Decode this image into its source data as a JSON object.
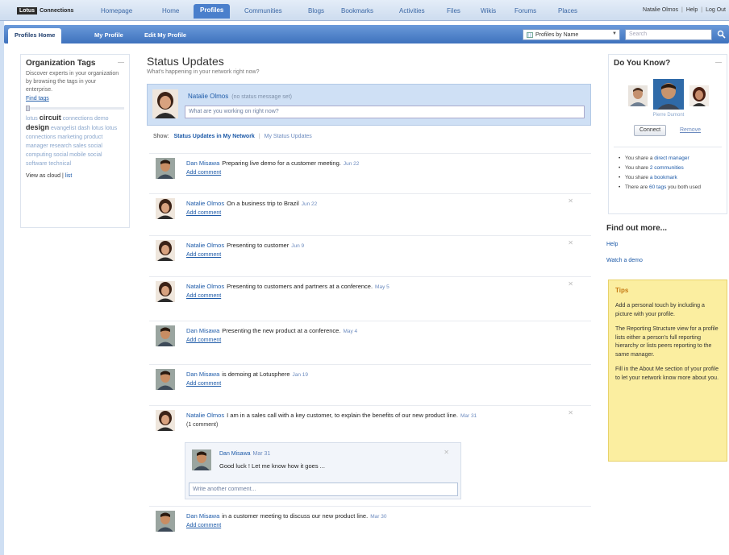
{
  "topnav": {
    "logo_box": "Lotus",
    "logo_text": "Connections",
    "items": [
      "Homepage",
      "Home",
      "Profiles",
      "Communities",
      "Blogs",
      "Bookmarks",
      "Activities",
      "Files",
      "Wikis",
      "Forums",
      "Places"
    ],
    "active": "Profiles",
    "user": "Natalie Olmos",
    "help": "Help",
    "logout": "Log Out"
  },
  "subnav": {
    "tabs": [
      "Profiles Home",
      "My Profile",
      "Edit My Profile"
    ],
    "active": "Profiles Home",
    "search_scope": "Profiles by Name",
    "search_placeholder": "Search"
  },
  "org_tags": {
    "title": "Organization Tags",
    "description": "Discover experts in your organization by browsing the tags in your enterprise.",
    "find_tags": "Find tags",
    "tags": [
      {
        "text": "lotus",
        "big": false
      },
      {
        "text": "circuit",
        "big": true
      },
      {
        "text": "connections",
        "big": false
      },
      {
        "text": "demo",
        "big": false
      },
      {
        "text": "design",
        "big": true
      },
      {
        "text": "evangelist",
        "big": false
      },
      {
        "text": "dash lotus lotus connections",
        "big": false
      },
      {
        "text": "marketing product manager",
        "big": false
      },
      {
        "text": "research sales social",
        "big": false
      },
      {
        "text": "computing social mobile",
        "big": false
      },
      {
        "text": "social software technical",
        "big": false
      }
    ],
    "view_as_label": "View as cloud",
    "view_as_alt": "list"
  },
  "status": {
    "title": "Status Updates",
    "subtitle": "What's happening in your network right now?",
    "compose_name": "Natalie Olmos",
    "compose_note": "(no status message set)",
    "compose_placeholder": "What are you working on right now?",
    "show_label": "Show:",
    "show_selected": "Status Updates in My Network",
    "show_other": "My Status Updates"
  },
  "feed": [
    {
      "who": "Dan Misawa",
      "text": "Preparing live demo for a customer meeting.",
      "date": "Jun 22",
      "action": "Add comment",
      "person": "dan",
      "closable": false
    },
    {
      "who": "Natalie Olmos",
      "text": "On a business trip to Brazil",
      "date": "Jun 22",
      "action": "Add comment",
      "person": "natalie",
      "closable": true
    },
    {
      "who": "Natalie Olmos",
      "text": "Presenting to customer",
      "date": "Jun 9",
      "action": "Add comment",
      "person": "natalie",
      "closable": true
    },
    {
      "who": "Natalie Olmos",
      "text": "Presenting to customers and partners at a conference.",
      "date": "May 5",
      "action": "Add comment",
      "person": "natalie",
      "closable": true
    },
    {
      "who": "Dan Misawa",
      "text": "Presenting the new product at a conference.",
      "date": "May 4",
      "action": "Add comment",
      "person": "dan",
      "closable": false
    },
    {
      "who": "Dan Misawa",
      "text": "is demoing at Lotusphere",
      "date": "Jan 19",
      "action": "Add comment",
      "person": "dan",
      "closable": false
    },
    {
      "who": "Natalie Olmos",
      "text": "I am in a sales call with a key customer, to explain the benefits of our new product line.",
      "date": "Mar 31",
      "action": "(1 comment)",
      "person": "natalie",
      "closable": true
    },
    {
      "who": "Dan Misawa",
      "text": "in a customer meeting to discuss our new product line.",
      "date": "Mar 30",
      "action": "Add comment",
      "person": "dan",
      "closable": false
    }
  ],
  "reply": {
    "who": "Dan Misawa",
    "date": "Mar 31",
    "text": "Good luck ! Let me know how it goes ...",
    "placeholder": "Write another comment..."
  },
  "do_you_know": {
    "title": "Do You Know?",
    "person_name": "Pierre Dumont",
    "connect": "Connect",
    "remove": "Remove",
    "items": [
      {
        "pre": "You share a ",
        "link": "direct manager",
        "post": ""
      },
      {
        "pre": "You share ",
        "link": "2 communities",
        "post": ""
      },
      {
        "pre": "You share ",
        "link": "a bookmark",
        "post": ""
      },
      {
        "pre": "There are ",
        "link": "60 tags",
        "post": " you both used"
      }
    ]
  },
  "find_out_more": {
    "title": "Find out more...",
    "links": [
      "Help",
      "Watch a demo"
    ]
  },
  "tips": {
    "title": "Tips",
    "paragraphs": [
      "Add a personal touch by including a picture with your profile.",
      "The Reporting Structure view for a profile lists either a person's full reporting hierarchy or lists peers reporting to the same manager.",
      "Fill in the About Me section of your profile to let your network know more about you."
    ]
  },
  "colors": {
    "accent": "#4a7fcc",
    "link": "#1d5aa8",
    "tips_bg": "#fbeea0"
  }
}
